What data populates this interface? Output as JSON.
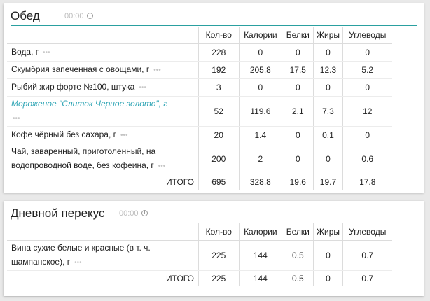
{
  "meals": {
    "lunch": {
      "title": "Обед",
      "time": "00:00",
      "columns": [
        "Кол-во",
        "Калории",
        "Белки",
        "Жиры",
        "Углеводы"
      ],
      "rows": [
        {
          "name": "Вода, г",
          "qty": "228",
          "kcal": "0",
          "protein": "0",
          "fat": "0",
          "carbs": "0"
        },
        {
          "name": "Скумбрия запеченная с овощами, г",
          "qty": "192",
          "kcal": "205.8",
          "protein": "17.5",
          "fat": "12.3",
          "carbs": "5.2"
        },
        {
          "name": "Рыбий жир форте №100, штука",
          "qty": "3",
          "kcal": "0",
          "protein": "0",
          "fat": "0",
          "carbs": "0"
        },
        {
          "name": "Мороженое \"Слиток Черное золото\", г",
          "qty": "52",
          "kcal": "119.6",
          "protein": "2.1",
          "fat": "7.3",
          "carbs": "12"
        },
        {
          "name": "Кофе чёрный без сахара, г",
          "qty": "20",
          "kcal": "1.4",
          "protein": "0",
          "fat": "0.1",
          "carbs": "0"
        },
        {
          "name": "Чай, заваренный, приготоленный, на водопроводной воде, без кофеина, г",
          "qty": "200",
          "kcal": "2",
          "protein": "0",
          "fat": "0",
          "carbs": "0.6"
        }
      ],
      "total": {
        "label": "ИТОГО",
        "qty": "695",
        "kcal": "328.8",
        "protein": "19.6",
        "fat": "19.7",
        "carbs": "17.8"
      }
    },
    "snack": {
      "title": "Дневной перекус",
      "time": "00:00",
      "columns": [
        "Кол-во",
        "Калории",
        "Белки",
        "Жиры",
        "Углеводы"
      ],
      "rows": [
        {
          "name": "Вина сухие белые и красные (в т. ч. шампанское), г",
          "qty": "225",
          "kcal": "144",
          "protein": "0.5",
          "fat": "0",
          "carbs": "0.7"
        }
      ],
      "total": {
        "label": "ИТОГО",
        "qty": "225",
        "kcal": "144",
        "protein": "0.5",
        "fat": "0",
        "carbs": "0.7"
      }
    }
  },
  "ui": {
    "more_dots": "•••",
    "clock_icon": "clock-icon",
    "accent_color": "#2aa0a0",
    "link_color": "#2ca4b4"
  }
}
